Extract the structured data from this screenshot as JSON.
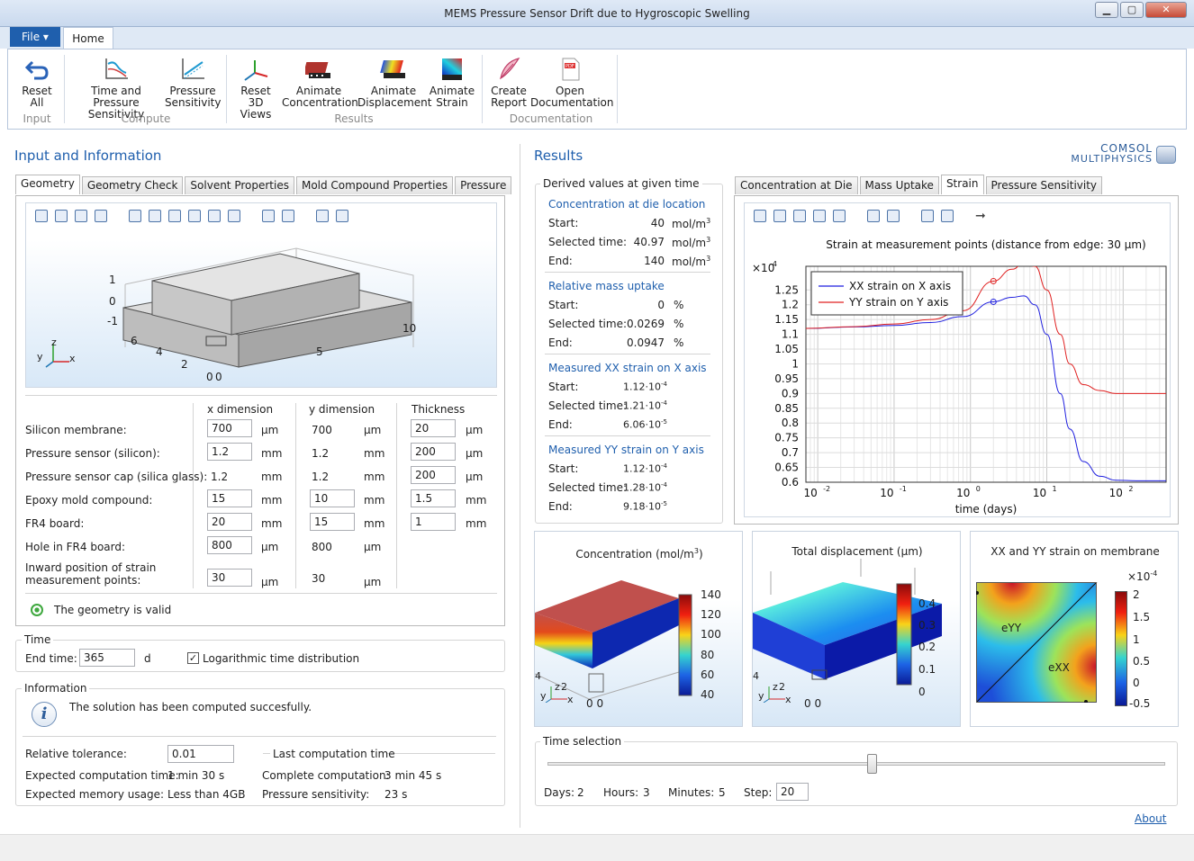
{
  "window": {
    "title": "MEMS Pressure Sensor Drift due to Hygroscopic Swelling",
    "btn_min": "▁",
    "btn_max": "▢",
    "btn_close": "✕"
  },
  "ribbon": {
    "file_tab": "File ▾",
    "home_tab": "Home",
    "buttons": {
      "reset_all": "Reset All",
      "time_pressure": "Time and Pressure Sensitivity",
      "pressure_sens": "Pressure Sensitivity",
      "reset_3d": "Reset 3D Views",
      "anim_conc": "Animate Concentration",
      "anim_disp": "Animate Displacement",
      "anim_strain": "Animate Strain",
      "create_report": "Create Report",
      "open_doc": "Open Documentation"
    },
    "groups": {
      "input": "Input",
      "compute": "Compute",
      "results": "Results",
      "documentation": "Documentation"
    }
  },
  "left": {
    "title": "Input and Information",
    "tabs": [
      "Geometry",
      "Geometry Check",
      "Solvent Properties",
      "Mold Compound Properties",
      "Pressure"
    ],
    "geom_axis_labels": {
      "z1": "1",
      "z0": "0",
      "zm1": "-1",
      "y6": "6",
      "y4": "4",
      "y2": "2",
      "y0": "0",
      "x0": "0",
      "x5": "5",
      "x10": "10",
      "ax_z": "z",
      "ax_y": "y",
      "ax_x": "x"
    },
    "col_headers": {
      "x": "x dimension",
      "y": "y dimension",
      "t": "Thickness"
    },
    "rows": [
      {
        "label": "Silicon membrane:",
        "x": "700",
        "xu": "µm",
        "y": "700",
        "yu": "µm",
        "t": "20",
        "tu": "µm"
      },
      {
        "label": "Pressure sensor (silicon):",
        "x": "1.2",
        "xu": "mm",
        "y": "1.2",
        "yu": "mm",
        "t": "200",
        "tu": "µm"
      },
      {
        "label": "Pressure sensor cap (silica glass):",
        "x": "1.2",
        "xu": "mm",
        "y": "1.2",
        "yu": "mm",
        "t": "200",
        "tu": "µm"
      },
      {
        "label": "Epoxy mold compound:",
        "x": "15",
        "xu": "mm",
        "y": "10",
        "yu": "mm",
        "t": "1.5",
        "tu": "mm"
      },
      {
        "label": "FR4 board:",
        "x": "20",
        "xu": "mm",
        "y": "15",
        "yu": "mm",
        "t": "1",
        "tu": "mm"
      },
      {
        "label": "Hole in FR4 board:",
        "x": "800",
        "xu": "µm",
        "y": "800",
        "yu": "µm",
        "t": "",
        "tu": ""
      },
      {
        "label": "Inward position of strain measurement points:",
        "x": "30",
        "xu": "µm",
        "y": "30",
        "yu": "µm",
        "t": "",
        "tu": ""
      }
    ],
    "valid": "The geometry is valid",
    "time": {
      "title": "Time",
      "end_label": "End time:",
      "end_value": "365",
      "end_unit": "d",
      "log_label": "Logarithmic time distribution",
      "log_checked": true
    },
    "info": {
      "title": "Information",
      "message": "The solution has been computed succesfully.",
      "rel_tol_label": "Relative tolerance:",
      "rel_tol": "0.01",
      "exp_time_label": "Expected computation time:",
      "exp_time": "1 min 30 s",
      "exp_mem_label": "Expected memory usage:",
      "exp_mem": "Less than 4GB",
      "last_title": "Last computation time",
      "complete_label": "Complete computation:",
      "complete": "3 min 45 s",
      "psens_label": "Pressure sensitivity:",
      "psens": "23 s"
    }
  },
  "results": {
    "title": "Results",
    "logo_line1": "COMSOL",
    "logo_line2": "MULTIPHYSICS",
    "derived_title": "Derived values at given time",
    "start": "Start:",
    "selected": "Selected time:",
    "end": "End:",
    "conc": {
      "title": "Concentration at die location",
      "start": "40",
      "sel": "40.97",
      "end": "140",
      "unit": "mol/m",
      "sup": "3"
    },
    "mass": {
      "title": "Relative mass uptake",
      "start": "0",
      "sel": "0.0269",
      "end": "0.0947",
      "unit": "%"
    },
    "xx": {
      "title": "Measured XX strain on X axis",
      "start": "1.12·10",
      "start_e": "-4",
      "sel": "1.21·10",
      "sel_e": "-4",
      "end": "6.06·10",
      "end_e": "-5"
    },
    "yy": {
      "title": "Measured YY strain on Y axis",
      "start": "1.12·10",
      "start_e": "-4",
      "sel": "1.28·10",
      "sel_e": "-4",
      "end": "9.18·10",
      "end_e": "-5"
    },
    "tabs": [
      "Concentration at Die",
      "Mass Uptake",
      "Strain",
      "Pressure Sensitivity"
    ],
    "conc_plot": {
      "title": "Concentration (mol/m",
      "title_sup": "3",
      "title_end": ")",
      "ticks": [
        "140",
        "120",
        "100",
        "80",
        "60",
        "40"
      ]
    },
    "disp_plot": {
      "title": "Total displacement (µm)",
      "ticks": [
        "0.4",
        "0.3",
        "0.2",
        "0.1",
        "0"
      ]
    },
    "strain_map": {
      "title": "XX and YY strain on membrane",
      "mult": "×10",
      "mult_e": "-4",
      "ticks": [
        "2",
        "1.5",
        "1",
        "0.5",
        "0",
        "-0.5"
      ],
      "eyy": "eYY",
      "exx": "eXX"
    },
    "small_axes": {
      "conc": {
        "n4": "4",
        "z": "z",
        "n2": "2",
        "y": "y",
        "x": "x",
        "zero": "0 0"
      },
      "disp": {
        "n4": "4",
        "z": "z",
        "n2": "2",
        "y": "y",
        "x": "x",
        "zero": "0 0"
      }
    },
    "time_sel": {
      "title": "Time selection",
      "slider_fraction": 0.53,
      "days_label": "Days:",
      "days": "2",
      "hours_label": "Hours:",
      "hours": "3",
      "minutes_label": "Minutes:",
      "minutes": "5",
      "step_label": "Step:",
      "step": "20"
    },
    "about": "About"
  },
  "chart_data": {
    "type": "line",
    "title": "Strain at measurement points (distance from edge: 30 µm)",
    "xlabel": "time (days)",
    "ylabel": "",
    "y_multiplier": "×10",
    "y_multiplier_exp": "-4",
    "xscale": "log",
    "xlim": [
      0.007,
      365
    ],
    "ylim": [
      0.6,
      1.33
    ],
    "xticks": [
      {
        "v": 0.01,
        "b": "10",
        "e": "-2"
      },
      {
        "v": 0.1,
        "b": "10",
        "e": "-1"
      },
      {
        "v": 1,
        "b": "10",
        "e": "0"
      },
      {
        "v": 10,
        "b": "10",
        "e": "1"
      },
      {
        "v": 100,
        "b": "10",
        "e": "2"
      }
    ],
    "yticks": [
      0.6,
      0.65,
      0.7,
      0.75,
      0.8,
      0.85,
      0.9,
      0.95,
      1,
      1.05,
      1.1,
      1.15,
      1.2,
      1.25
    ],
    "grid": true,
    "legend": "top-left",
    "marker_x": 2,
    "series": [
      {
        "name": "XX strain on X axis",
        "color": "#1f1fdf",
        "x": [
          0.007,
          0.03,
          0.1,
          0.3,
          0.8,
          2,
          3.5,
          5,
          7,
          10,
          15,
          20,
          30,
          50,
          80,
          150,
          365
        ],
        "y": [
          1.12,
          1.125,
          1.13,
          1.14,
          1.16,
          1.21,
          1.225,
          1.23,
          1.2,
          1.1,
          0.9,
          0.78,
          0.67,
          0.62,
          0.607,
          0.605,
          0.605
        ]
      },
      {
        "name": "YY strain on Y axis",
        "color": "#e02020",
        "x": [
          0.007,
          0.03,
          0.1,
          0.3,
          0.8,
          2,
          3.5,
          5,
          7,
          10,
          15,
          20,
          30,
          50,
          80,
          150,
          365
        ],
        "y": [
          1.12,
          1.126,
          1.135,
          1.15,
          1.18,
          1.28,
          1.32,
          1.34,
          1.33,
          1.25,
          1.1,
          1.0,
          0.93,
          0.91,
          0.9,
          0.9,
          0.9
        ]
      }
    ]
  }
}
